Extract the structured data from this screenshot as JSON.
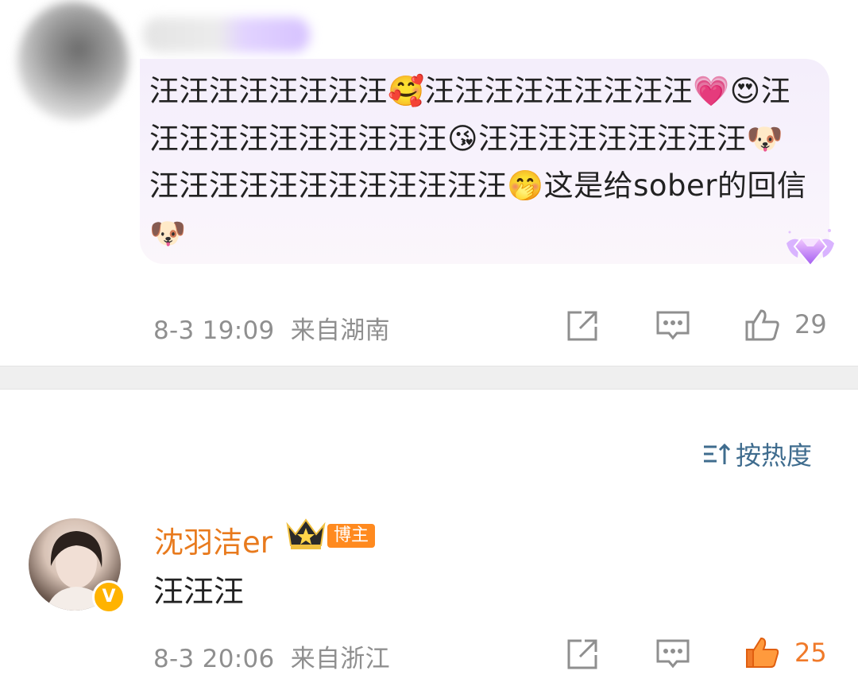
{
  "comment1": {
    "bubble_text": "汪汪汪汪汪汪汪汪🥰汪汪汪汪汪汪汪汪汪💗😍汪汪汪汪汪汪汪汪汪汪汪😘汪汪汪汪汪汪汪汪汪🐶汪汪汪汪汪汪汪汪汪汪汪汪🤭这是给sober的回信🐶",
    "timestamp": "8-3 19:09",
    "location": "来自湖南",
    "like_count": "29"
  },
  "sort": {
    "label": "按热度",
    "icon": "sort-icon"
  },
  "comment2": {
    "username": "沈羽洁er",
    "tag": "博主",
    "verified_mark": "V",
    "text": "汪汪汪",
    "timestamp": "8-3 20:06",
    "location": "来自浙江",
    "like_count": "25"
  },
  "colors": {
    "username": "#e87a1d",
    "liked": "#f07a2a",
    "meta": "#8f8f8f",
    "sort": "#3f6c8e",
    "bubble": "#f4eefb"
  }
}
